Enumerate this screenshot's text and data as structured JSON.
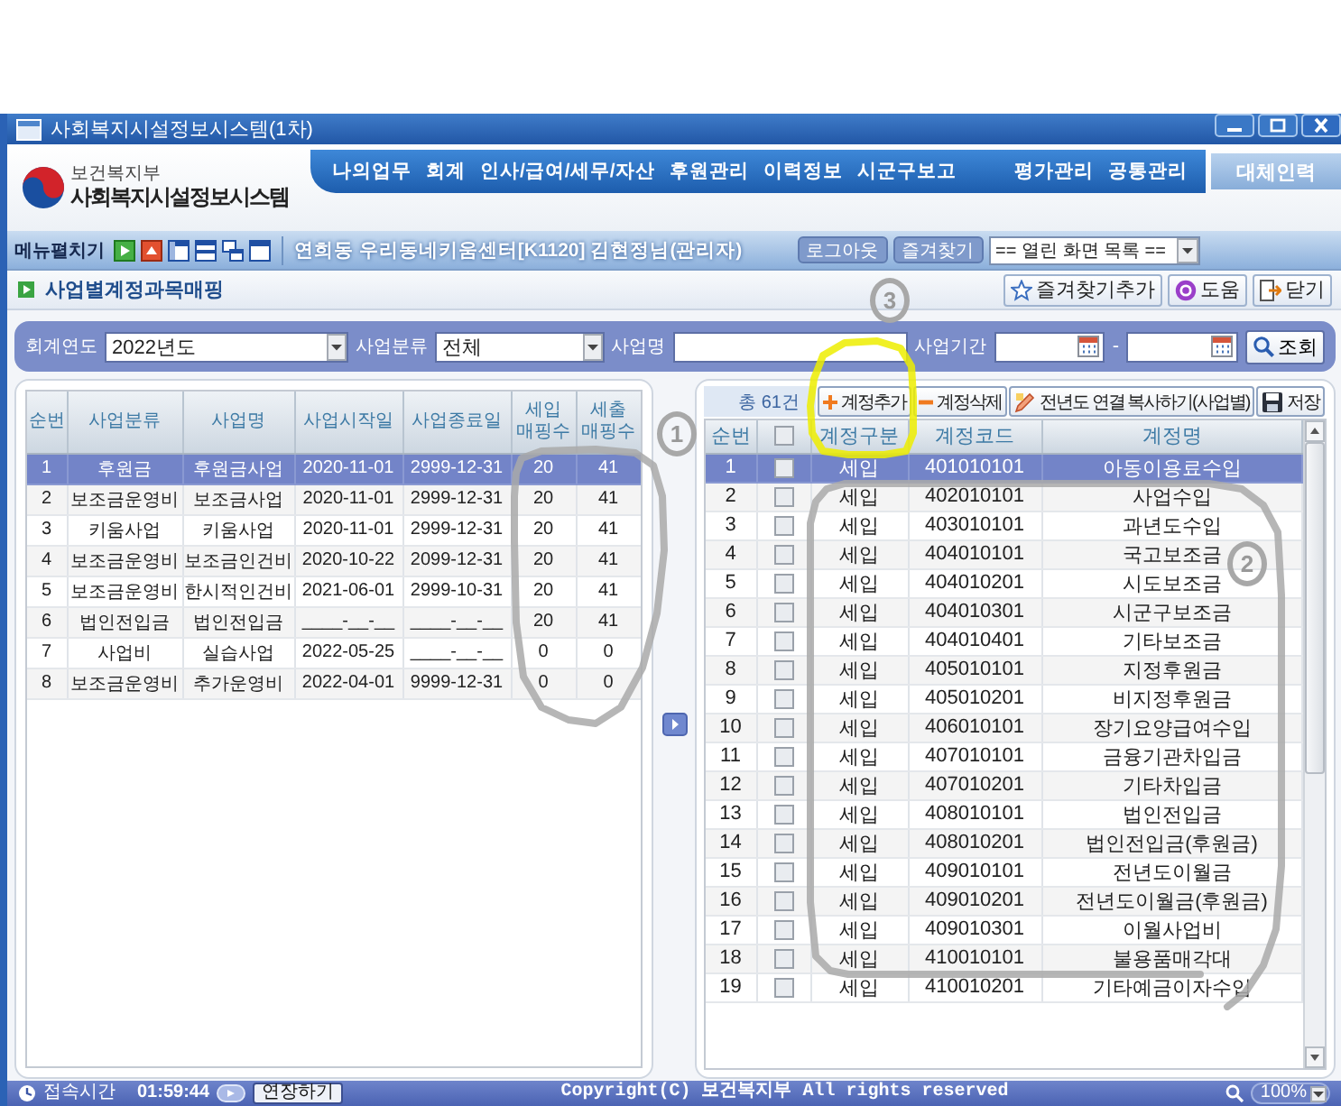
{
  "window": {
    "title": "사회복지시설정보시스템(1차)"
  },
  "header": {
    "logo": {
      "ministry": "보건복지부",
      "system_name": "사회복지시설정보시스템"
    },
    "menu_left": [
      "나의업무",
      "회계",
      "인사/급여/세무/자산",
      "후원관리",
      "이력정보",
      "시군구보고"
    ],
    "menu_right": [
      "평가관리",
      "공통관리"
    ],
    "side_button": "대체인력"
  },
  "toolbar": {
    "menu_toggle": "메뉴펼치기",
    "user_info": "연희동 우리동네키움센터[K1120] 김현정님(관리자)",
    "buttons": [
      "로그아웃",
      "즐겨찾기"
    ],
    "open_screens": "== 열린 화면 목록 =="
  },
  "page": {
    "title": "사업별계정과목매핑",
    "actions": [
      {
        "kind": "favorite",
        "label": "즐겨찾기추가"
      },
      {
        "kind": "help",
        "label": "도움"
      },
      {
        "kind": "close",
        "label": "닫기"
      }
    ]
  },
  "filters": {
    "fiscal_year": {
      "label": "회계연도",
      "value": "2022년도"
    },
    "business_type": {
      "label": "사업분류",
      "value": "전체"
    },
    "business_name": {
      "label": "사업명"
    },
    "period": {
      "label": "사업기간",
      "separator": "-"
    },
    "search_button": "조회"
  },
  "left_table": {
    "columns": [
      "순번",
      "사업분류",
      "사업명",
      "사업시작일",
      "사업종료일",
      "세입 매핑수",
      "세출 매핑수"
    ],
    "rows": [
      {
        "cells": [
          "1",
          "후원금",
          "후원금사업",
          "2020-11-01",
          "2999-12-31",
          "20",
          "41"
        ],
        "selected": true
      },
      {
        "cells": [
          "2",
          "보조금운영비",
          "보조금사업",
          "2020-11-01",
          "2999-12-31",
          "20",
          "41"
        ],
        "selected": false
      },
      {
        "cells": [
          "3",
          "키움사업",
          "키움사업",
          "2020-11-01",
          "2999-12-31",
          "20",
          "41"
        ],
        "selected": false
      },
      {
        "cells": [
          "4",
          "보조금운영비",
          "보조금인건비",
          "2020-10-22",
          "2099-12-31",
          "20",
          "41"
        ],
        "selected": false
      },
      {
        "cells": [
          "5",
          "보조금운영비",
          "한시적인건비",
          "2021-06-01",
          "2999-10-31",
          "20",
          "41"
        ],
        "selected": false
      },
      {
        "cells": [
          "6",
          "법인전입금",
          "법인전입금",
          "____-__-__",
          "____-__-__",
          "20",
          "41"
        ],
        "selected": false
      },
      {
        "cells": [
          "7",
          "사업비",
          "실습사업",
          "2022-05-25",
          "____-__-__",
          "0",
          "0"
        ],
        "selected": false
      },
      {
        "cells": [
          "8",
          "보조금운영비",
          "추가운영비",
          "2022-04-01",
          "9999-12-31",
          "0",
          "0"
        ],
        "selected": false
      }
    ]
  },
  "right_panel": {
    "count": "총 61건",
    "buttons": [
      {
        "kind": "add",
        "label": "계정추가"
      },
      {
        "kind": "delete",
        "label": "계정삭제"
      },
      {
        "kind": "copy",
        "label": "전년도 연결 복사하기(사업별)"
      },
      {
        "kind": "save",
        "label": "저장"
      }
    ]
  },
  "right_table": {
    "header_checkbox": {
      "checked": false
    },
    "columns": [
      "순번",
      "계정구분",
      "계정코드",
      "계정명"
    ],
    "rows": [
      {
        "cells": [
          "1",
          "세입",
          "401010101",
          "아동이용료수입"
        ],
        "checked": false,
        "selected": true
      },
      {
        "cells": [
          "2",
          "세입",
          "402010101",
          "사업수입"
        ],
        "checked": false,
        "selected": false
      },
      {
        "cells": [
          "3",
          "세입",
          "403010101",
          "과년도수입"
        ],
        "checked": false,
        "selected": false
      },
      {
        "cells": [
          "4",
          "세입",
          "404010101",
          "국고보조금"
        ],
        "checked": false,
        "selected": false
      },
      {
        "cells": [
          "5",
          "세입",
          "404010201",
          "시도보조금"
        ],
        "checked": false,
        "selected": false
      },
      {
        "cells": [
          "6",
          "세입",
          "404010301",
          "시군구보조금"
        ],
        "checked": false,
        "selected": false
      },
      {
        "cells": [
          "7",
          "세입",
          "404010401",
          "기타보조금"
        ],
        "checked": false,
        "selected": false
      },
      {
        "cells": [
          "8",
          "세입",
          "405010101",
          "지정후원금"
        ],
        "checked": false,
        "selected": false
      },
      {
        "cells": [
          "9",
          "세입",
          "405010201",
          "비지정후원금"
        ],
        "checked": false,
        "selected": false
      },
      {
        "cells": [
          "10",
          "세입",
          "406010101",
          "장기요양급여수입"
        ],
        "checked": false,
        "selected": false
      },
      {
        "cells": [
          "11",
          "세입",
          "407010101",
          "금융기관차입금"
        ],
        "checked": false,
        "selected": false
      },
      {
        "cells": [
          "12",
          "세입",
          "407010201",
          "기타차입금"
        ],
        "checked": false,
        "selected": false
      },
      {
        "cells": [
          "13",
          "세입",
          "408010101",
          "법인전입금"
        ],
        "checked": false,
        "selected": false
      },
      {
        "cells": [
          "14",
          "세입",
          "408010201",
          "법인전입금(후원금)"
        ],
        "checked": false,
        "selected": false
      },
      {
        "cells": [
          "15",
          "세입",
          "409010101",
          "전년도이월금"
        ],
        "checked": false,
        "selected": false
      },
      {
        "cells": [
          "16",
          "세입",
          "409010201",
          "전년도이월금(후원금)"
        ],
        "checked": false,
        "selected": false
      },
      {
        "cells": [
          "17",
          "세입",
          "409010301",
          "이월사업비"
        ],
        "checked": false,
        "selected": false
      },
      {
        "cells": [
          "18",
          "세입",
          "410010101",
          "불용품매각대"
        ],
        "checked": false,
        "selected": false
      },
      {
        "cells": [
          "19",
          "세입",
          "410010201",
          "기타예금이자수입"
        ],
        "checked": false,
        "selected": false
      }
    ]
  },
  "status_bar": {
    "session_label": "접속시간",
    "session_time": "01:59:44",
    "extend_button": "연장하기",
    "copyright": "Copyright(C) 보건복지부 All rights reserved",
    "zoom": "100%"
  },
  "annotations": [
    {
      "kind": "pen",
      "label": "1"
    },
    {
      "kind": "pen",
      "label": "2"
    },
    {
      "kind": "highlighter",
      "label": "3"
    }
  ]
}
